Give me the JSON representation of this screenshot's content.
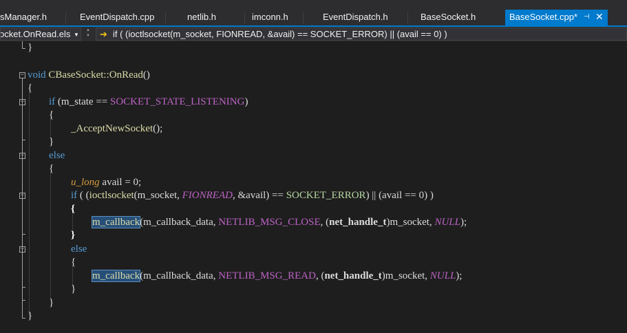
{
  "tabs": [
    {
      "label": "sManager.h",
      "active": false
    },
    {
      "label": "EventDispatch.cpp",
      "active": false
    },
    {
      "label": "netlib.h",
      "active": false
    },
    {
      "label": "imconn.h",
      "active": false
    },
    {
      "label": "EventDispatch.h",
      "active": false
    },
    {
      "label": "BaseSocket.h",
      "active": false
    },
    {
      "label": "BaseSocket.cpp*",
      "active": true
    }
  ],
  "tab_icons": {
    "pin": "pin-icon",
    "close": "close-icon"
  },
  "nav": {
    "scope": "ocket.OnRead.els",
    "arrow_icon": "arrow-right-icon",
    "member": "if ( (ioctlsocket(m_socket, FIONREAD, &avail) == SOCKET_ERROR) || (avail == 0) )"
  },
  "code_tokens": {
    "close_brace": "}",
    "open_brace": "{",
    "void": "void",
    "class_scope": "CBaseSocket::",
    "method": "OnRead",
    "parens": "()",
    "if": "if",
    "else": "else",
    "m_state": "(m_state == ",
    "listening": "SOCKET_STATE_LISTENING",
    "close_paren": ")",
    "accept": "_AcceptNewSocket",
    "call_end": "();",
    "u_long": "u_long",
    "avail_decl": " avail = 0;",
    "if_open": " ( (",
    "ioctlsocket": "ioctlsocket",
    "ioctl_args": "(m_socket, ",
    "fionread": "FIONREAD",
    "avail_ref": ", &avail) == ",
    "socket_error": "SOCKET_ERROR",
    "cond_tail": ") || (avail == 0) )",
    "m_callback": "m_callback",
    "cb_args": "(m_callback_data, ",
    "msg_close": "NETLIB_MSG_CLOSE",
    "msg_read": "NETLIB_MSG_READ",
    "cast_open": ", (",
    "net_handle": "net_handle_t",
    "cast_close": ")m_socket, ",
    "null": "NULL",
    "stmt_end": ");"
  }
}
